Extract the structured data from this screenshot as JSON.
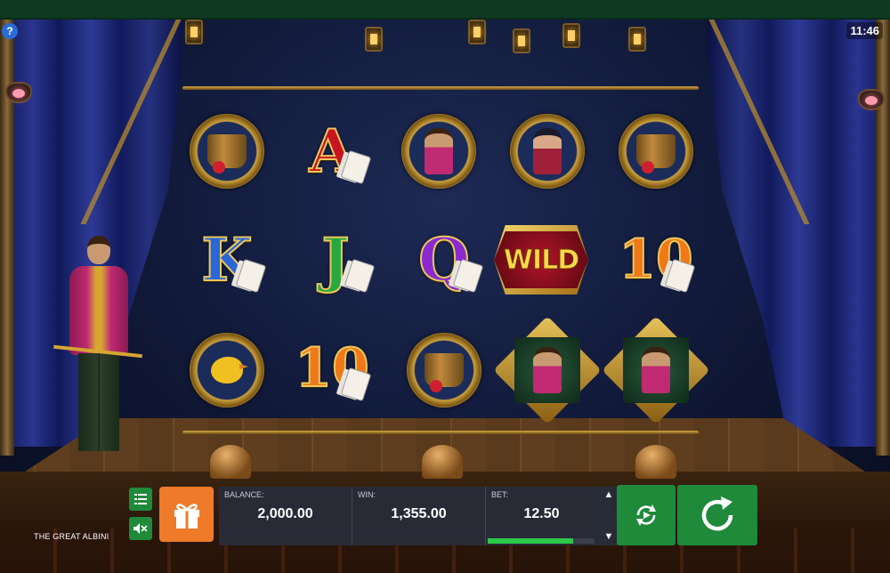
{
  "header": {
    "help_label": "?",
    "clock": "11:46"
  },
  "game": {
    "title": "THE GREAT ALBINI"
  },
  "reels": {
    "rows": [
      [
        {
          "symbol": "hat-medallion",
          "text": ""
        },
        {
          "symbol": "letter-a",
          "text": "A"
        },
        {
          "symbol": "magician-medallion",
          "text": ""
        },
        {
          "symbol": "assistant-medallion",
          "text": ""
        },
        {
          "symbol": "hat-medallion",
          "text": ""
        }
      ],
      [
        {
          "symbol": "letter-k",
          "text": "K"
        },
        {
          "symbol": "letter-j",
          "text": "J"
        },
        {
          "symbol": "letter-q",
          "text": "Q"
        },
        {
          "symbol": "wild",
          "text": "WILD"
        },
        {
          "symbol": "number-10",
          "text": "10"
        }
      ],
      [
        {
          "symbol": "canary-medallion",
          "text": ""
        },
        {
          "symbol": "number-10",
          "text": "10"
        },
        {
          "symbol": "hat-medallion",
          "text": ""
        },
        {
          "symbol": "magician-diamond",
          "text": ""
        },
        {
          "symbol": "magician-diamond",
          "text": ""
        }
      ]
    ]
  },
  "hud": {
    "balance_label": "BALANCE:",
    "balance_value": "2,000.00",
    "win_label": "WIN:",
    "win_value": "1,355.00",
    "bet_label": "BET:",
    "bet_value": "12.50",
    "bet_level_fraction": 0.8,
    "bet_up_label": "▲",
    "bet_down_label": "▼"
  },
  "icons": {
    "menu": "list-icon",
    "sound": "sound-muted-icon",
    "gift": "gift-icon",
    "autoplay": "autoplay-icon",
    "spin": "spin-icon"
  },
  "colors": {
    "button_green": "#1e8a3a",
    "gift_orange": "#ef7a2a",
    "bet_bar": "#2cc84a",
    "panel": "#282c3a"
  }
}
